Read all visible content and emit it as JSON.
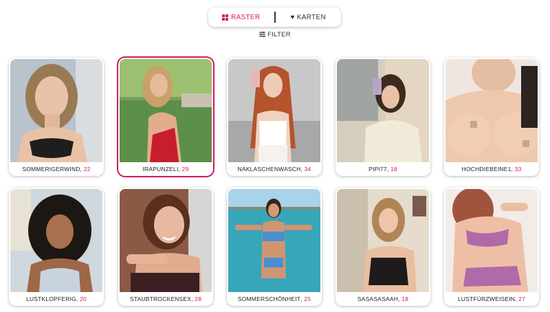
{
  "view_toggle": {
    "grid_label": "RASTER",
    "cards_label": "KARTEN"
  },
  "filter": {
    "label": "FILTER"
  },
  "colors": {
    "accent": "#d3175f"
  },
  "profiles": [
    {
      "name": "SOMMERIGERWIND",
      "age": "22"
    },
    {
      "name": "IRAPUNZELI",
      "age": "29"
    },
    {
      "name": "NAKLASCHENWASCH",
      "age": "34"
    },
    {
      "name": "PIPI77",
      "age": "18"
    },
    {
      "name": "HOCHDIEBEINE1",
      "age": "33"
    },
    {
      "name": "LUSTKLOPFERIG",
      "age": "20"
    },
    {
      "name": "STAUBTROCKENSEX",
      "age": "28"
    },
    {
      "name": "SOMMERSCHÖNHEIT",
      "age": "25"
    },
    {
      "name": "SASASASAAH",
      "age": "18"
    },
    {
      "name": "LUSTFÜRZWEISEIN",
      "age": "27"
    }
  ]
}
